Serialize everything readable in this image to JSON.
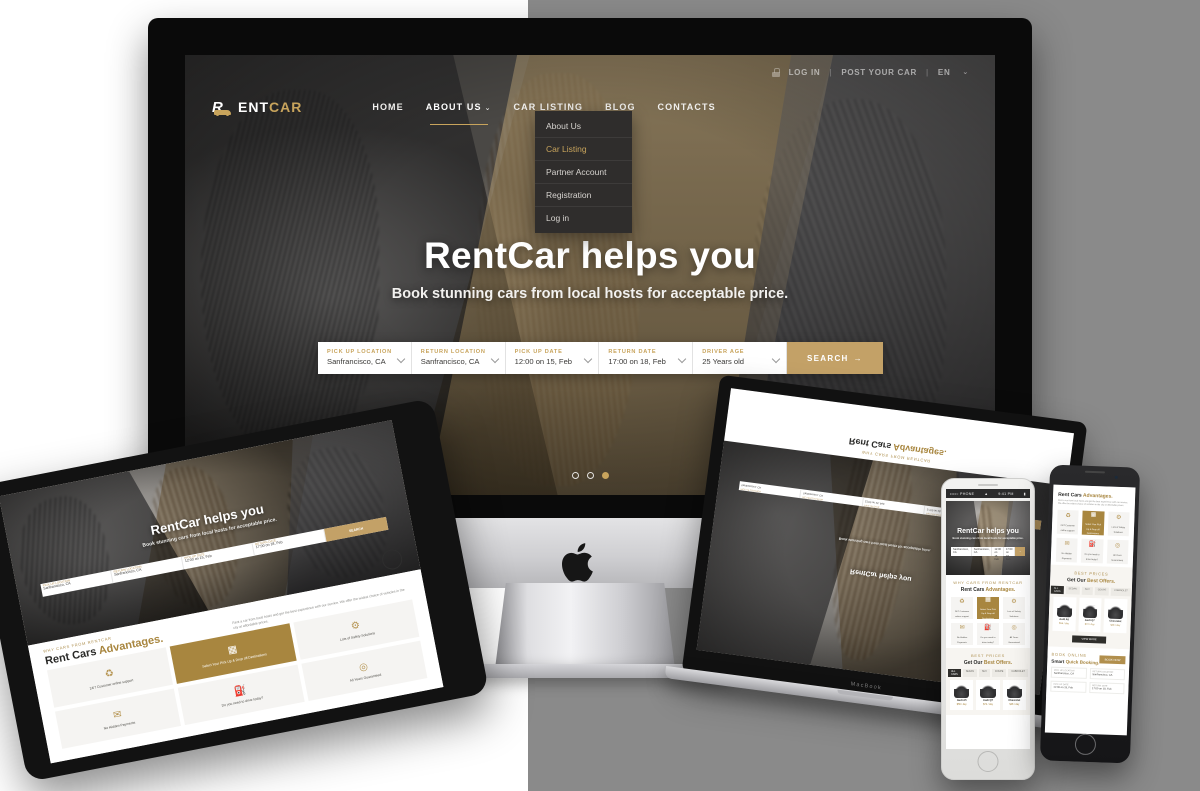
{
  "site": {
    "logo": {
      "prefix": "ENT",
      "suffix": "CAR",
      "mark": "rentcar-logo-icon"
    }
  },
  "topbar": {
    "login": "LOG IN",
    "post": "POST YOUR CAR",
    "lang": "EN",
    "sep": "|",
    "lock_icon": "lock-icon",
    "caret": "⌄"
  },
  "nav": {
    "items": [
      {
        "label": "HOME",
        "active": false
      },
      {
        "label": "ABOUT US",
        "active": true,
        "caret": "⌄"
      },
      {
        "label": "CAR LISTING",
        "active": false
      },
      {
        "label": "BLOG",
        "active": false
      },
      {
        "label": "CONTACTS",
        "active": false
      }
    ],
    "dropdown": [
      {
        "label": "About Us",
        "highlighted": false
      },
      {
        "label": "Car Listing",
        "highlighted": true
      },
      {
        "label": "Partner Account",
        "highlighted": false
      },
      {
        "label": "Registration",
        "highlighted": false
      },
      {
        "label": "Log in",
        "highlighted": false
      }
    ]
  },
  "hero": {
    "title": "RentCar helps you",
    "subtitle": "Book stunning cars from local hosts for acceptable price.",
    "dots": [
      false,
      false,
      true
    ]
  },
  "search": {
    "fields": [
      {
        "label": "PICK UP LOCATION",
        "value": "Sanfrancisco, CA"
      },
      {
        "label": "RETURN LOCATION",
        "value": "Sanfrancisco, CA"
      },
      {
        "label": "PICK UP DATE",
        "value": "12:00 on 15, Feb"
      },
      {
        "label": "RETURN DATE",
        "value": "17:00 on 18, Feb"
      },
      {
        "label": "DRIVER AGE",
        "value": "25 Years old"
      }
    ],
    "button": "SEARCH",
    "button_arrow": "→"
  },
  "advantages": {
    "eyebrow": "WHY CARS FROM RENTCAR",
    "title_plain": "Rent Cars ",
    "title_accent": "Advantages.",
    "intro": "Rent a car from local hosts and get the best experience with our service. We offer the widest choice of vehicles in the city at affordable prices.",
    "cards": [
      {
        "icon": "♻",
        "text": "24/7 Customer online support",
        "highlight": false
      },
      {
        "icon": "▦",
        "text": "Select Your Pick Up & Drop off Destinations",
        "highlight": true
      },
      {
        "icon": "⚙",
        "text": "Lots of Safety Solutions",
        "highlight": false
      },
      {
        "icon": "✉",
        "text": "No Hidden Payments",
        "highlight": false
      },
      {
        "icon": "⛽",
        "text": "Do you need to drive today?",
        "highlight": false
      },
      {
        "icon": "◎",
        "text": "All Years Guaranteed",
        "highlight": false
      }
    ]
  },
  "offers": {
    "eyebrow": "BEST PRICES",
    "title_plain": "Get Our ",
    "title_accent": "Best Offers.",
    "tabs": [
      {
        "label": "ALL CARS",
        "active": true
      },
      {
        "label": "SEDAN",
        "active": false
      },
      {
        "label": "SUV",
        "active": false
      },
      {
        "label": "COUPE",
        "active": false
      },
      {
        "label": "CABRIOLET",
        "active": false
      }
    ],
    "cars": [
      {
        "name": "Audi A5",
        "price": "$56 / day"
      },
      {
        "name": "Audi Q7",
        "price": "$72 / day"
      },
      {
        "name": "Chevrolet",
        "price": "$48 / day"
      }
    ],
    "more_button": "VIEW MORE"
  },
  "booking": {
    "eyebrow": "BOOK ONLINE",
    "title_plain": "Smart ",
    "title_accent": "Quick Booking.",
    "button": "BOOK NOW",
    "fields": [
      {
        "label": "PICK UP LOCATION",
        "value": "Sanfrancisco, CA"
      },
      {
        "label": "RETURN LOCATION",
        "value": "Sanfrancisco, CA"
      },
      {
        "label": "PICK UP DATE",
        "value": "12:00 on 15, Feb"
      },
      {
        "label": "RETURN DATE",
        "value": "17:00 on 18, Feb"
      }
    ]
  },
  "devices": {
    "imac": {
      "brand_icon": "apple-logo-icon"
    },
    "macbook": {
      "label": "MacBook"
    },
    "phone_white": {
      "status_left": "••••○ PHONE",
      "status_wifi": "▲",
      "status_time": "9:41 PM",
      "status_right": "▮"
    }
  },
  "colors": {
    "gold": "#c8a45c",
    "gold_button": "#c3a167",
    "gold_card": "#a8863f",
    "dark": "#2f2d2c",
    "bg_grey": "#8a8a8a",
    "white": "#ffffff"
  }
}
